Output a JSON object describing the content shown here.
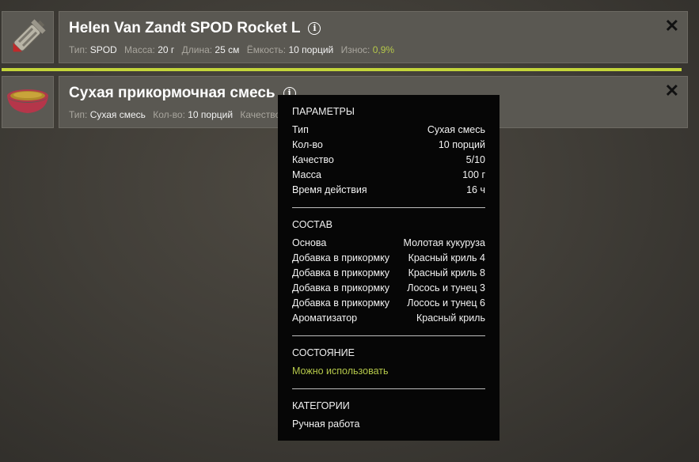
{
  "items": [
    {
      "title": "Helen Van Zandt SPOD Rocket L",
      "meta": [
        {
          "k": "Тип:",
          "v": "SPOD"
        },
        {
          "k": "Масса:",
          "v": "20 г"
        },
        {
          "k": "Длина:",
          "v": "25 см"
        },
        {
          "k": "Ёмкость:",
          "v": "10 порций"
        },
        {
          "k": "Износ:",
          "v": "0,9%"
        }
      ]
    },
    {
      "title": "Сухая прикормочная смесь",
      "meta": [
        {
          "k": "Тип:",
          "v": "Сухая смесь"
        },
        {
          "k": "Кол-во:",
          "v": "10 порций"
        },
        {
          "k": "Качество:",
          "v": ""
        }
      ]
    }
  ],
  "tooltip": {
    "params_title": "ПАРАМЕТРЫ",
    "params": [
      {
        "k": "Тип",
        "v": "Сухая смесь"
      },
      {
        "k": "Кол-во",
        "v": "10 порций"
      },
      {
        "k": "Качество",
        "v": "5/10"
      },
      {
        "k": "Масса",
        "v": "100 г"
      },
      {
        "k": "Время действия",
        "v": "16 ч"
      }
    ],
    "composition_title": "СОСТАВ",
    "composition": [
      {
        "k": "Основа",
        "v": "Молотая кукуруза"
      },
      {
        "k": "Добавка в прикормку",
        "v": "Красный криль 4"
      },
      {
        "k": "Добавка в прикормку",
        "v": "Красный криль 8"
      },
      {
        "k": "Добавка в прикормку",
        "v": "Лосось и тунец 3"
      },
      {
        "k": "Добавка в прикормку",
        "v": "Лосось и тунец 6"
      },
      {
        "k": "Ароматизатор",
        "v": "Красный криль"
      }
    ],
    "state_title": "СОСТОЯНИЕ",
    "state": "Можно использовать",
    "categories_title": "КАТЕГОРИИ",
    "category": "Ручная работа"
  },
  "colors": {
    "accent_green": "#b5c84a",
    "wear_bar": "#c3d43a"
  },
  "icons": {
    "info": "info-icon",
    "close": "close-icon",
    "rocket": "spod-rocket-icon",
    "bowl": "groundbait-bowl-icon"
  }
}
